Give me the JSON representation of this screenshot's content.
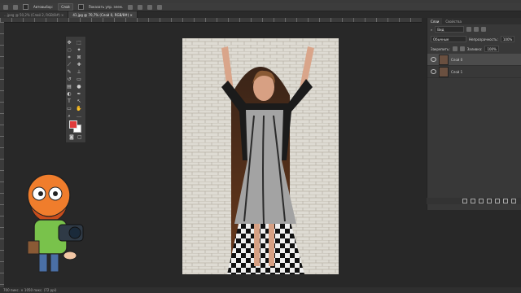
{
  "options_bar": {
    "autoselect_label": "Автовыбор:",
    "autoselect_value": "Слой",
    "show_controls_label": "Показать упр. элем."
  },
  "tabs": [
    {
      "label": "...jpeg @ 50,2% (Слой 2, RGB/8#)",
      "active": false
    },
    {
      "label": "41.jpg @ 70,7% (Слой 0, RGB/8#)",
      "active": true
    }
  ],
  "layers_panel": {
    "tabs": [
      "Слои",
      "Свойства"
    ],
    "filter_label": "Вид",
    "blend_mode": "Обычные",
    "opacity_label": "Непрозрачность:",
    "opacity_value": "100%",
    "lock_label": "Закрепить:",
    "fill_label": "Заливка:",
    "fill_value": "100%",
    "layers": [
      {
        "name": "Слой 0",
        "selected": true
      },
      {
        "name": "Слой 1",
        "selected": false
      }
    ]
  },
  "status": {
    "text": "700 пикс. × 1050 пикс. (72 ppi)"
  },
  "colors": {
    "foreground": "#e03a3a",
    "background": "#ffffff"
  }
}
